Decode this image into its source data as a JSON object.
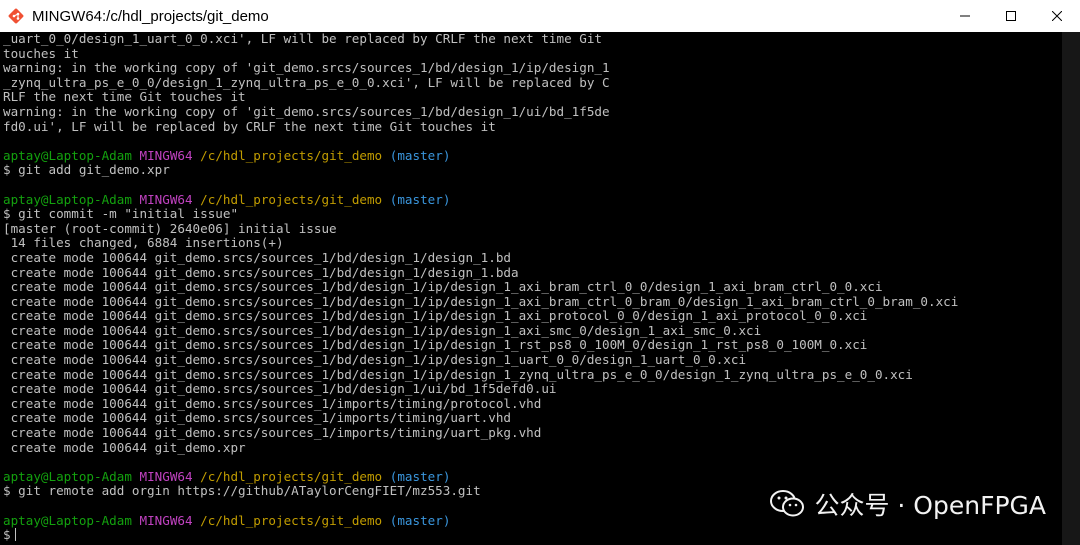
{
  "window": {
    "title": "MINGW64:/c/hdl_projects/git_demo"
  },
  "prompt": {
    "user": "aptay@Laptop-Adam",
    "system": "MINGW64",
    "path": "/c/hdl_projects/git_demo",
    "branch": "(master)",
    "symbol": "$"
  },
  "lines": [
    "_uart_0_0/design_1_uart_0_0.xci', LF will be replaced by CRLF the next time Git",
    "touches it",
    "warning: in the working copy of 'git_demo.srcs/sources_1/bd/design_1/ip/design_1",
    "_zynq_ultra_ps_e_0_0/design_1_zynq_ultra_ps_e_0_0.xci', LF will be replaced by C",
    "RLF the next time Git touches it",
    "warning: in the working copy of 'git_demo.srcs/sources_1/bd/design_1/ui/bd_1f5de",
    "fd0.ui', LF will be replaced by CRLF the next time Git touches it",
    "",
    "#prompt",
    "$ git add git_demo.xpr",
    "",
    "#prompt",
    "$ git commit -m \"initial issue\"",
    "[master (root-commit) 2640e06] initial issue",
    " 14 files changed, 6884 insertions(+)",
    " create mode 100644 git_demo.srcs/sources_1/bd/design_1/design_1.bd",
    " create mode 100644 git_demo.srcs/sources_1/bd/design_1/design_1.bda",
    " create mode 100644 git_demo.srcs/sources_1/bd/design_1/ip/design_1_axi_bram_ctrl_0_0/design_1_axi_bram_ctrl_0_0.xci",
    " create mode 100644 git_demo.srcs/sources_1/bd/design_1/ip/design_1_axi_bram_ctrl_0_bram_0/design_1_axi_bram_ctrl_0_bram_0.xci",
    " create mode 100644 git_demo.srcs/sources_1/bd/design_1/ip/design_1_axi_protocol_0_0/design_1_axi_protocol_0_0.xci",
    " create mode 100644 git_demo.srcs/sources_1/bd/design_1/ip/design_1_axi_smc_0/design_1_axi_smc_0.xci",
    " create mode 100644 git_demo.srcs/sources_1/bd/design_1/ip/design_1_rst_ps8_0_100M_0/design_1_rst_ps8_0_100M_0.xci",
    " create mode 100644 git_demo.srcs/sources_1/bd/design_1/ip/design_1_uart_0_0/design_1_uart_0_0.xci",
    " create mode 100644 git_demo.srcs/sources_1/bd/design_1/ip/design_1_zynq_ultra_ps_e_0_0/design_1_zynq_ultra_ps_e_0_0.xci",
    " create mode 100644 git_demo.srcs/sources_1/bd/design_1/ui/bd_1f5defd0.ui",
    " create mode 100644 git_demo.srcs/sources_1/imports/timing/protocol.vhd",
    " create mode 100644 git_demo.srcs/sources_1/imports/timing/uart.vhd",
    " create mode 100644 git_demo.srcs/sources_1/imports/timing/uart_pkg.vhd",
    " create mode 100644 git_demo.xpr",
    "",
    "#prompt",
    "$ git remote add orgin https://github/ATaylorCengFIET/mz553.git",
    "",
    "#prompt",
    "#cursor"
  ],
  "watermark": {
    "text": "公众号 · OpenFPGA",
    "icon": "wechat-icon"
  },
  "colors": {
    "background": "#000000",
    "text": "#c0c0c0",
    "user": "#13a10e",
    "mingw": "#c042c0",
    "path": "#c19c00",
    "branch": "#3a96dd"
  }
}
